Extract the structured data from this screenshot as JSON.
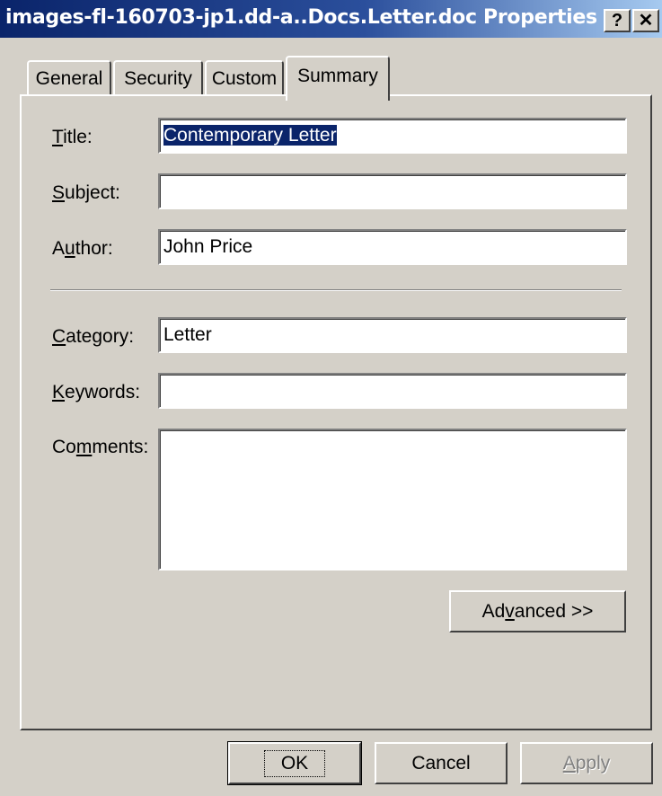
{
  "window": {
    "title": "images-fl-160703-jp1.dd-a..Docs.Letter.doc Properties",
    "help_button": "?",
    "close_button": "✕"
  },
  "tabs": [
    {
      "label": "General",
      "active": false
    },
    {
      "label": "Security",
      "active": false
    },
    {
      "label": "Custom",
      "active": false
    },
    {
      "label": "Summary",
      "active": true
    }
  ],
  "fields": {
    "title": {
      "label_pre": "",
      "label_key": "T",
      "label_post": "itle:",
      "value": "Contemporary Letter"
    },
    "subject": {
      "label_pre": "",
      "label_key": "S",
      "label_post": "ubject:",
      "value": ""
    },
    "author": {
      "label_pre": "A",
      "label_key": "u",
      "label_post": "thor:",
      "value": "John Price"
    },
    "category": {
      "label_pre": "",
      "label_key": "C",
      "label_post": "ategory:",
      "value": "Letter"
    },
    "keywords": {
      "label_pre": "",
      "label_key": "K",
      "label_post": "eywords:",
      "value": ""
    },
    "comments": {
      "label_pre": "Co",
      "label_key": "m",
      "label_post": "ments:",
      "value": ""
    }
  },
  "advanced_button": {
    "pre": "Ad",
    "key": "v",
    "post": "anced >>"
  },
  "footer": {
    "ok": "OK",
    "cancel": "Cancel",
    "apply_key": "A",
    "apply_post": "pply"
  }
}
